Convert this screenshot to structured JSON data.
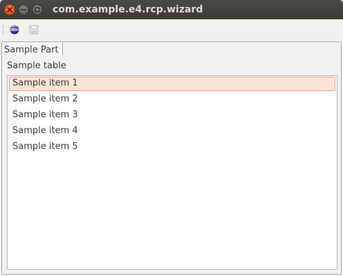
{
  "window": {
    "title": "com.example.e4.rcp.wizard"
  },
  "toolbar": {
    "items": [
      {
        "icon": "eclipse-about-icon",
        "enabled": true
      },
      {
        "icon": "save-icon",
        "enabled": false
      }
    ]
  },
  "part": {
    "tab_label": "Sample Part",
    "table_caption": "Sample table",
    "rows": [
      {
        "label": "Sample item 1",
        "selected": true
      },
      {
        "label": "Sample item 2",
        "selected": false
      },
      {
        "label": "Sample item 3",
        "selected": false
      },
      {
        "label": "Sample item 4",
        "selected": false
      },
      {
        "label": "Sample item 5",
        "selected": false
      }
    ]
  },
  "colors": {
    "titlebar": "#3c3b37",
    "close_button": "#e2521a",
    "selection_fill": "#fde2d8",
    "selection_border": "#f0a58a"
  }
}
